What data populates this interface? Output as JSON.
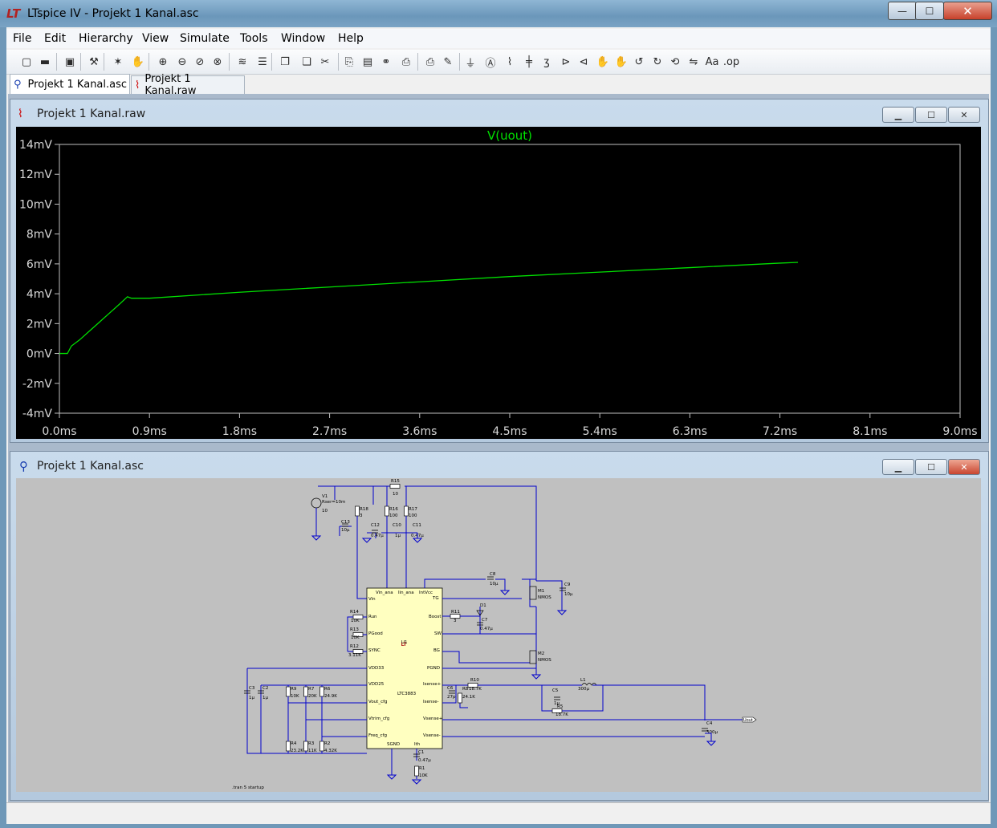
{
  "window": {
    "title": "LTspice IV - Projekt 1 Kanal.asc",
    "app_icon": "ltspice-logo-icon"
  },
  "caption_buttons": {
    "minimize": "—",
    "maximize": "☐",
    "close": "✕"
  },
  "menu": [
    "File",
    "Edit",
    "Hierarchy",
    "View",
    "Simulate",
    "Tools",
    "Window",
    "Help"
  ],
  "toolbar_icons": [
    "open-icon",
    "folder-icon",
    "save-icon",
    "control-panel-icon",
    "run-icon",
    "pan-icon",
    "zoom-in-icon",
    "zoom-out-icon",
    "zoom-back-icon",
    "zoom-fit-icon",
    "autorange-icon",
    "tile-horizontal-icon",
    "cascade-icon",
    "tile-vertical-icon",
    "cut-icon",
    "copy-icon",
    "paste-icon",
    "find-icon",
    "print-setup-icon",
    "print-icon",
    "draw-wire-icon",
    "ground-icon",
    "label-net-icon",
    "resistor-icon",
    "capacitor-icon",
    "inductor-icon",
    "diode-icon",
    "component-icon",
    "move-icon",
    "drag-icon",
    "undo-icon",
    "redo-icon",
    "rotate-icon",
    "mirror-icon",
    "text-icon",
    "spice-directive-icon"
  ],
  "tabs": [
    {
      "label": "Projekt 1 Kanal.asc",
      "icon": "schematic-icon",
      "active": true
    },
    {
      "label": "Projekt 1 Kanal.raw",
      "icon": "waveform-icon",
      "active": false
    }
  ],
  "plot_window": {
    "title": "Projekt 1 Kanal.raw",
    "icon": "waveform-icon"
  },
  "schematic_window": {
    "title": "Projekt 1 Kanal.asc",
    "icon": "schematic-icon",
    "directive": ".tran 5 startup"
  },
  "colors": {
    "trace": "#00e000",
    "plot_bg": "#000000",
    "grid": "#c0c0c0",
    "wire": "#0000cc",
    "schem_bg": "#c0c0c0",
    "ic_fill": "#ffffc0"
  },
  "chart_data": {
    "type": "line",
    "title": "V(uout)",
    "xlabel": "",
    "ylabel": "",
    "xlim": [
      0,
      9.0
    ],
    "ylim": [
      -4,
      14
    ],
    "xticks": [
      "0.0ms",
      "0.9ms",
      "1.8ms",
      "2.7ms",
      "3.6ms",
      "4.5ms",
      "5.4ms",
      "6.3ms",
      "7.2ms",
      "8.1ms",
      "9.0ms"
    ],
    "yticks": [
      "14mV",
      "12mV",
      "10mV",
      "8mV",
      "6mV",
      "4mV",
      "2mV",
      "0mV",
      "-2mV",
      "-4mV"
    ],
    "series": [
      {
        "name": "V(uout)",
        "x": [
          0.0,
          0.08,
          0.12,
          0.2,
          0.3,
          0.4,
          0.5,
          0.6,
          0.68,
          0.72,
          0.9,
          1.8,
          2.7,
          3.6,
          4.5,
          5.4,
          6.3,
          7.2,
          7.38
        ],
        "y": [
          0.0,
          0.0,
          0.5,
          0.9,
          1.5,
          2.1,
          2.7,
          3.3,
          3.8,
          3.7,
          3.7,
          4.1,
          4.45,
          4.8,
          5.15,
          5.45,
          5.75,
          6.05,
          6.1
        ]
      }
    ]
  },
  "schematic_labels": {
    "v1": "V1",
    "v1_val": "Rser=10m",
    "v1_v": "10",
    "r15": "R15",
    "r15_v": "10",
    "r16": "R16",
    "r16_v": "100",
    "r17": "R17",
    "r17_v": "100",
    "r18": "R18",
    "r18_v": "3",
    "c13": "C13",
    "c13_v": "10µ",
    "c12": "C12",
    "c12_v": "0.47µ",
    "c10": "C10",
    "c10_v": "1µ",
    "c11": "C11",
    "c11_v": "0.47µ",
    "c8": "C8",
    "c8_v": "10µ",
    "c9": "C9",
    "c9_v": "10µ",
    "m1": "M1",
    "m1_v": "NMOS",
    "m2": "M2",
    "m2_v": "NMOS",
    "d1": "D1",
    "c7": "C7",
    "c7_v": "0.47µ",
    "r11": "R11",
    "r11_v": "3",
    "r14": "R14",
    "r14_v": "10K",
    "r13": "R13",
    "r13_v": "10K",
    "r12": "R12",
    "r12_v": "3.11K",
    "u1": "U1",
    "ic_name": "LTC3883",
    "pin_vin": "Vin",
    "pin_inana": "Vin_ana",
    "pin_in": "Iin_ana",
    "pin_intvcc": "IntVcc",
    "pin_tg": "TG",
    "pin_boost": "Boost",
    "pin_sw": "SW",
    "pin_bg": "BG",
    "pin_pgnd": "PGND",
    "pin_isp": "Isense+",
    "pin_ism": "Isense-",
    "pin_vsp": "Vsense+",
    "pin_vsm": "Vsense-",
    "pin_run": "Run",
    "pin_pgood": "PGood",
    "pin_sync": "SYNC",
    "pin_vdd33": "VDD33",
    "pin_vdd25": "VDD25",
    "pin_voutcfg": "Vout_cfg",
    "pin_vtrimcfg": "Vtrim_cfg",
    "pin_freqcfg": "Freq_cfg",
    "pin_sgnd": "SGND",
    "pin_ith": "Ith",
    "c3": "C3",
    "c3_v": "1µ",
    "c2": "C2",
    "c2_v": "1µ",
    "r9": "R9",
    "r9_v": "10K",
    "r7": "R7",
    "r7_v": "20K",
    "r6": "R6",
    "r6_v": "24.9K",
    "r4": "R4",
    "r4_v": "23.2K",
    "r3": "R3",
    "r3_v": "11K",
    "r2": "R2",
    "r2_v": "4.32K",
    "c6": "C6",
    "c6_v": "27p",
    "r8": "R8",
    "r8_v": "24.1K",
    "r10": "R10",
    "r10_v": "18.7K",
    "c5": "C5",
    "c5_v": "1µ",
    "r5": "R5",
    "r5_v": "18.7K",
    "l1": "L1",
    "l1_v": "300µ",
    "c4": "C4",
    "c4_v": "300µ",
    "c1": "C1",
    "c1_v": "0.47µ",
    "r1": "R1",
    "r1_v": "10K",
    "uout": "Uout"
  }
}
